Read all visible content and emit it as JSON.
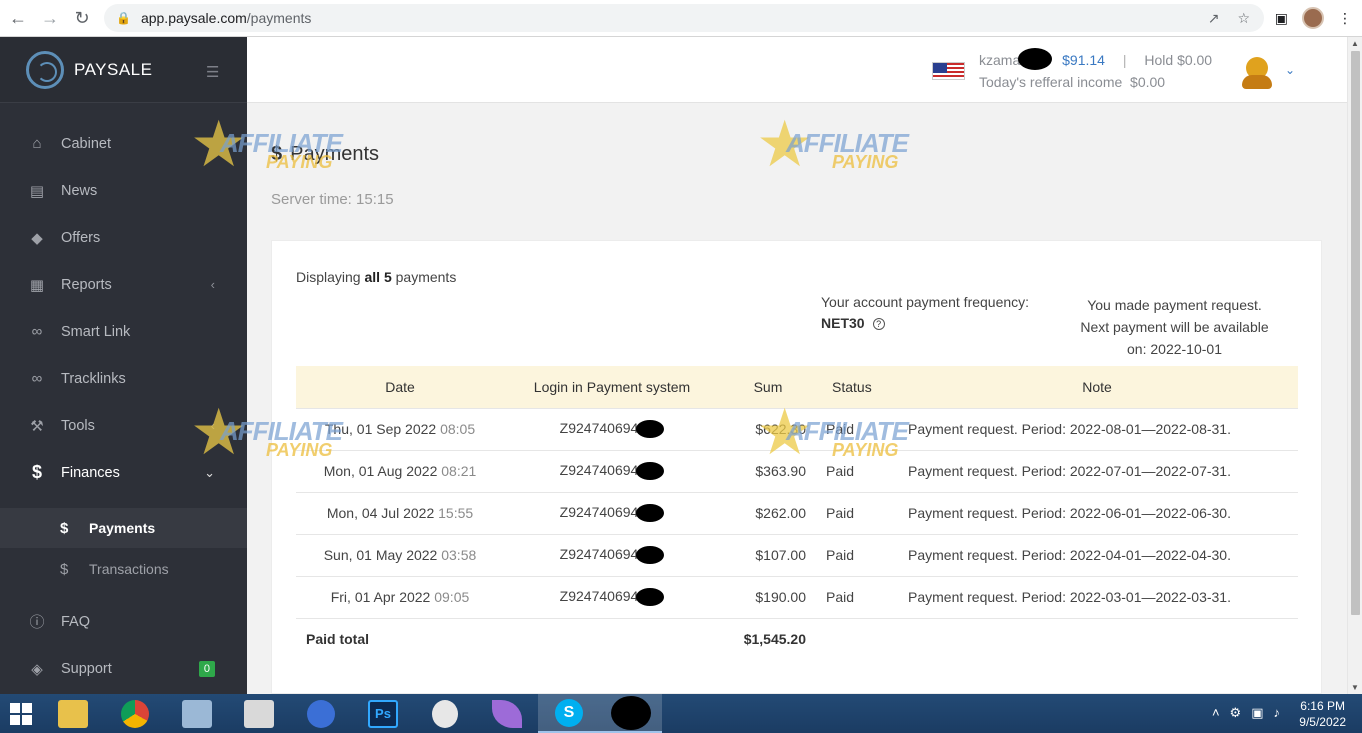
{
  "browser": {
    "url_host": "app.paysale.com",
    "url_path": "/payments"
  },
  "sidebar": {
    "brand": "PAYSALE",
    "items": [
      {
        "label": "Cabinet",
        "icon": "home-icon"
      },
      {
        "label": "News",
        "icon": "newspaper-icon"
      },
      {
        "label": "Offers",
        "icon": "tag-icon"
      },
      {
        "label": "Reports",
        "icon": "table-icon"
      },
      {
        "label": "Smart Link",
        "icon": "link-icon"
      },
      {
        "label": "Tracklinks",
        "icon": "link-icon"
      },
      {
        "label": "Tools",
        "icon": "wrench-icon"
      },
      {
        "label": "Finances",
        "icon": "dollar-icon"
      }
    ],
    "finances_sub": [
      {
        "label": "Payments"
      },
      {
        "label": "Transactions"
      }
    ],
    "faq": "FAQ",
    "support": "Support",
    "support_badge": "0"
  },
  "topbar": {
    "username": "kzama",
    "balance": "$91.14",
    "separator": "|",
    "hold_label": "Hold",
    "hold_value": "$0.00",
    "referral_label": "Today's refferal income",
    "referral_value": "$0.00"
  },
  "page": {
    "title": "Payments",
    "server_time_label": "Server time:",
    "server_time": "15:15",
    "displaying_pre": "Displaying",
    "displaying_bold": "all 5",
    "displaying_post": "payments",
    "frequency_label": "Your account payment frequency:",
    "frequency_value": "NET30",
    "notice_line1": "You made payment request.",
    "notice_line2": "Next payment will be available",
    "notice_line3": "on: 2022-10-01"
  },
  "table": {
    "headers": [
      "Date",
      "Login in Payment system",
      "Sum",
      "Status",
      "Note"
    ],
    "rows": [
      {
        "date": "Thu, 01 Sep 2022",
        "time": "08:05",
        "login": "Z924740694",
        "sum": "$622.30",
        "status": "Paid",
        "note": "Payment request. Period: 2022-08-01—2022-08-31."
      },
      {
        "date": "Mon, 01 Aug 2022",
        "time": "08:21",
        "login": "Z924740694",
        "sum": "$363.90",
        "status": "Paid",
        "note": "Payment request. Period: 2022-07-01—2022-07-31."
      },
      {
        "date": "Mon, 04 Jul 2022",
        "time": "15:55",
        "login": "Z924740694",
        "sum": "$262.00",
        "status": "Paid",
        "note": "Payment request. Period: 2022-06-01—2022-06-30."
      },
      {
        "date": "Sun, 01 May 2022",
        "time": "03:58",
        "login": "Z924740694",
        "sum": "$107.00",
        "status": "Paid",
        "note": "Payment request. Period: 2022-04-01—2022-04-30."
      },
      {
        "date": "Fri, 01 Apr 2022",
        "time": "09:05",
        "login": "Z924740694",
        "sum": "$190.00",
        "status": "Paid",
        "note": "Payment request. Period: 2022-03-01—2022-03-31."
      }
    ],
    "total_label": "Paid total",
    "total_value": "$1,545.20"
  },
  "watermark": {
    "line1": "AFFILIATE",
    "line2": "PAYING"
  },
  "taskbar": {
    "time": "6:16 PM",
    "date": "9/5/2022"
  },
  "colors": {
    "sidebar_bg": "#2d3038",
    "accent_blue": "#3a79c2",
    "table_header_bg": "#fcf5dd",
    "badge_green": "#2ea84a"
  }
}
